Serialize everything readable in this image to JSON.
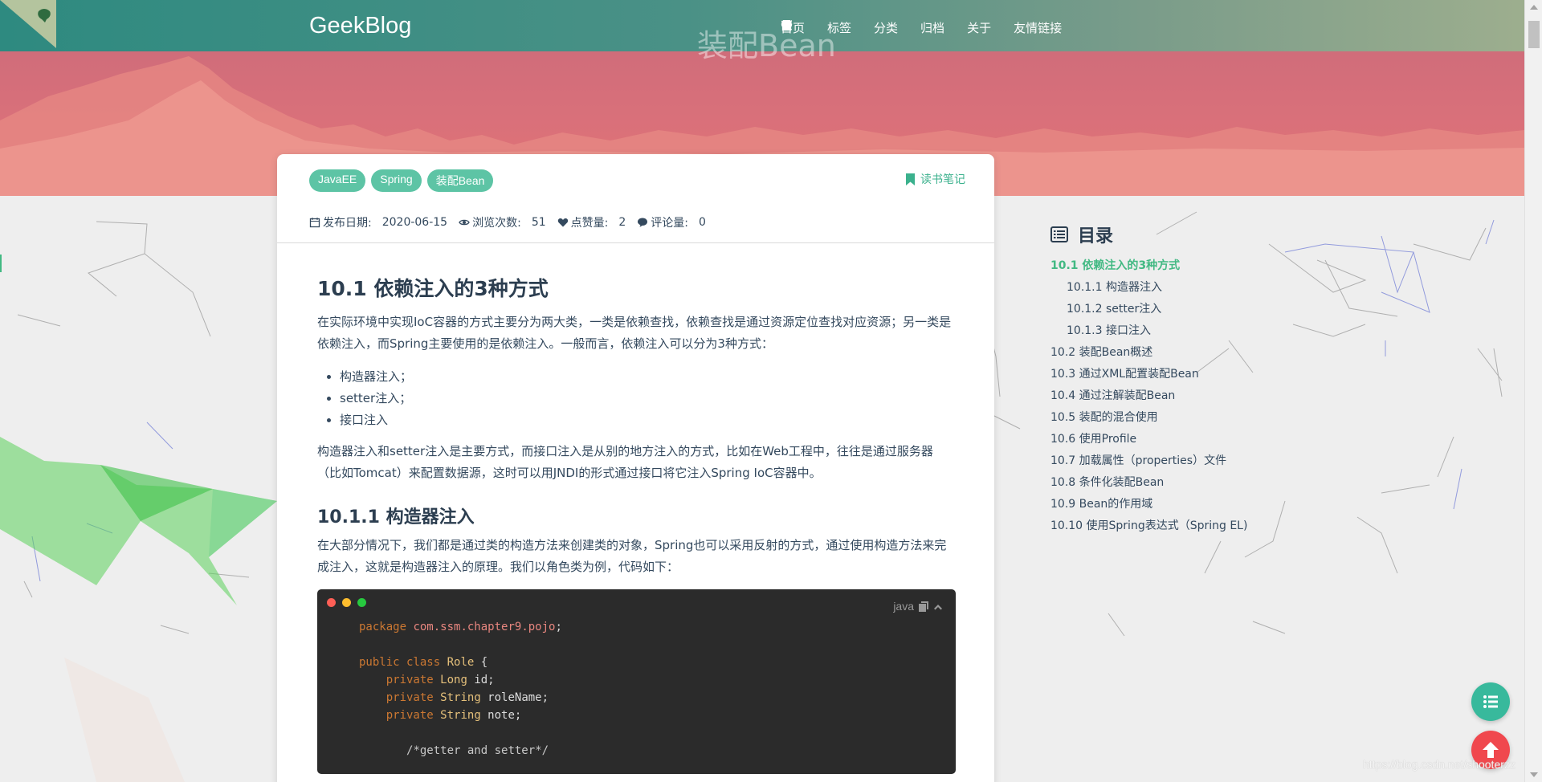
{
  "header": {
    "brand": "GeekBlog",
    "banner_title": "装配Bean",
    "nav": [
      {
        "label": "首页",
        "icon": "home-icon"
      },
      {
        "label": "标签",
        "icon": "tags-icon"
      },
      {
        "label": "分类",
        "icon": "bookmark-icon"
      },
      {
        "label": "归档",
        "icon": "archive-icon"
      },
      {
        "label": "关于",
        "icon": "paper-plane-icon"
      },
      {
        "label": "友情链接",
        "icon": "comment-icon"
      }
    ],
    "search_icon": "search-icon"
  },
  "article": {
    "tags": [
      "JavaEE",
      "Spring",
      "装配Bean"
    ],
    "category": "读书笔记",
    "meta": {
      "date_label": "发布日期:",
      "date": "2020-06-15",
      "views_label": "浏览次数:",
      "views": "51",
      "likes_label": "点赞量:",
      "likes": "2",
      "comments_label": "评论量:",
      "comments": "0"
    },
    "h1": "10.1 依赖注入的3种方式",
    "p1": "在实际环境中实现IoC容器的方式主要分为两大类，一类是依赖查找，依赖查找是通过资源定位查找对应资源；另一类是依赖注入，而Spring主要使用的是依赖注入。一般而言，依赖注入可以分为3种方式：",
    "list": [
      "构造器注入；",
      "setter注入；",
      "接口注入"
    ],
    "p2": "构造器注入和setter注入是主要方式，而接口注入是从别的地方注入的方式，比如在Web工程中，往往是通过服务器（比如Tomcat）来配置数据源，这时可以用JNDI的形式通过接口将它注入Spring IoC容器中。",
    "h2": "10.1.1 构造器注入",
    "p3": "在大部分情况下，我们都是通过类的构造方法来创建类的对象，Spring也可以采用反射的方式，通过使用构造方法来完成注入，这就是构造器注入的原理。我们以角色类为例，代码如下：",
    "code_lang": "java",
    "code": {
      "l1_kw": "package",
      "l1_pkg": "com.ssm.chapter9.pojo",
      "l1_end": ";",
      "l2_kw": "public class",
      "l2_name": "Role",
      "l2_end": " {",
      "f1_kw": "private",
      "f1_type": "Long",
      "f1_name": " id;",
      "f2_kw": "private",
      "f2_type": "String",
      "f2_name": " roleName;",
      "f3_kw": "private",
      "f3_type": "String",
      "f3_name": " note;",
      "comment": "/*getter and setter*/"
    }
  },
  "toc": {
    "title": "目录",
    "items": [
      {
        "label": "10.1 依赖注入的3种方式",
        "active": true,
        "level": 1
      },
      {
        "label": "10.1.1 构造器注入",
        "level": 2
      },
      {
        "label": "10.1.2 setter注入",
        "level": 2
      },
      {
        "label": "10.1.3 接口注入",
        "level": 2
      },
      {
        "label": "10.2 装配Bean概述",
        "level": 1
      },
      {
        "label": "10.3 通过XML配置装配Bean",
        "level": 1
      },
      {
        "label": "10.4 通过注解装配Bean",
        "level": 1
      },
      {
        "label": "10.5 装配的混合使用",
        "level": 1
      },
      {
        "label": "10.6 使用Profile",
        "level": 1
      },
      {
        "label": "10.7 加载属性（properties）文件",
        "level": 1
      },
      {
        "label": "10.8 条件化装配Bean",
        "level": 1
      },
      {
        "label": "10.9 Bean的作用域",
        "level": 1
      },
      {
        "label": "10.10 使用Spring表达式（Spring EL)",
        "level": 1
      }
    ]
  },
  "watermark": "https://blog.csdn.net/shooterzz",
  "colors": {
    "accent": "#42b983",
    "tag": "#5dc4a5",
    "fab_top": "#f0484e",
    "fab_toc": "#38b99c"
  }
}
